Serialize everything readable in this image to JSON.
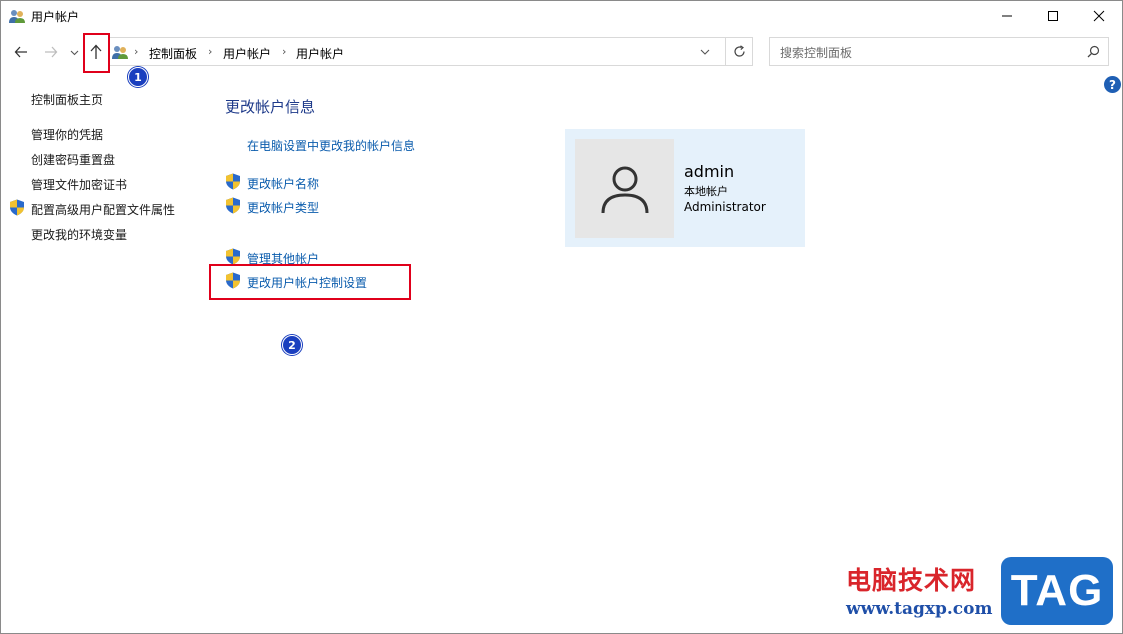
{
  "window": {
    "title": "用户帐户",
    "minimize_glyph": "—",
    "maximize_glyph": "☐",
    "close_glyph": "✕"
  },
  "nav": {
    "back_icon": "arrow-left-icon",
    "forward_icon": "arrow-right-icon",
    "recent_icon": "chevron-down-icon",
    "up_icon": "arrow-up-icon",
    "breadcrumbs": [
      "控制面板",
      "用户帐户",
      "用户帐户"
    ],
    "refresh_icon": "refresh-icon"
  },
  "search": {
    "placeholder": "搜索控制面板",
    "value": ""
  },
  "help": {
    "label": "?"
  },
  "sidebar": {
    "home": "控制面板主页",
    "items": [
      {
        "label": "管理你的凭据",
        "shield": false
      },
      {
        "label": "创建密码重置盘",
        "shield": false
      },
      {
        "label": "管理文件加密证书",
        "shield": false
      },
      {
        "label": "配置高级用户配置文件属性",
        "shield": true
      },
      {
        "label": "更改我的环境变量",
        "shield": false
      }
    ]
  },
  "main": {
    "title": "更改帐户信息",
    "settings_link": "在电脑设置中更改我的帐户信息",
    "links": [
      {
        "label": "更改帐户名称",
        "shield": true
      },
      {
        "label": "更改帐户类型",
        "shield": true
      },
      {
        "label": "管理其他帐户",
        "shield": true
      },
      {
        "label": "更改用户帐户控制设置",
        "shield": true
      }
    ]
  },
  "account": {
    "name": "admin",
    "type": "本地帐户",
    "role": "Administrator"
  },
  "annotations": {
    "badge1": "1",
    "badge2": "2"
  },
  "watermark": {
    "text": "电脑技术网",
    "url": "www.tagxp.com",
    "logo": "TAG"
  },
  "colors": {
    "accent_link": "#0b5cad",
    "title_blue": "#1e3a8a",
    "card_bg": "#e5f1fb",
    "annotation_red": "#e0001b",
    "badge_blue": "#1a3fbf"
  }
}
